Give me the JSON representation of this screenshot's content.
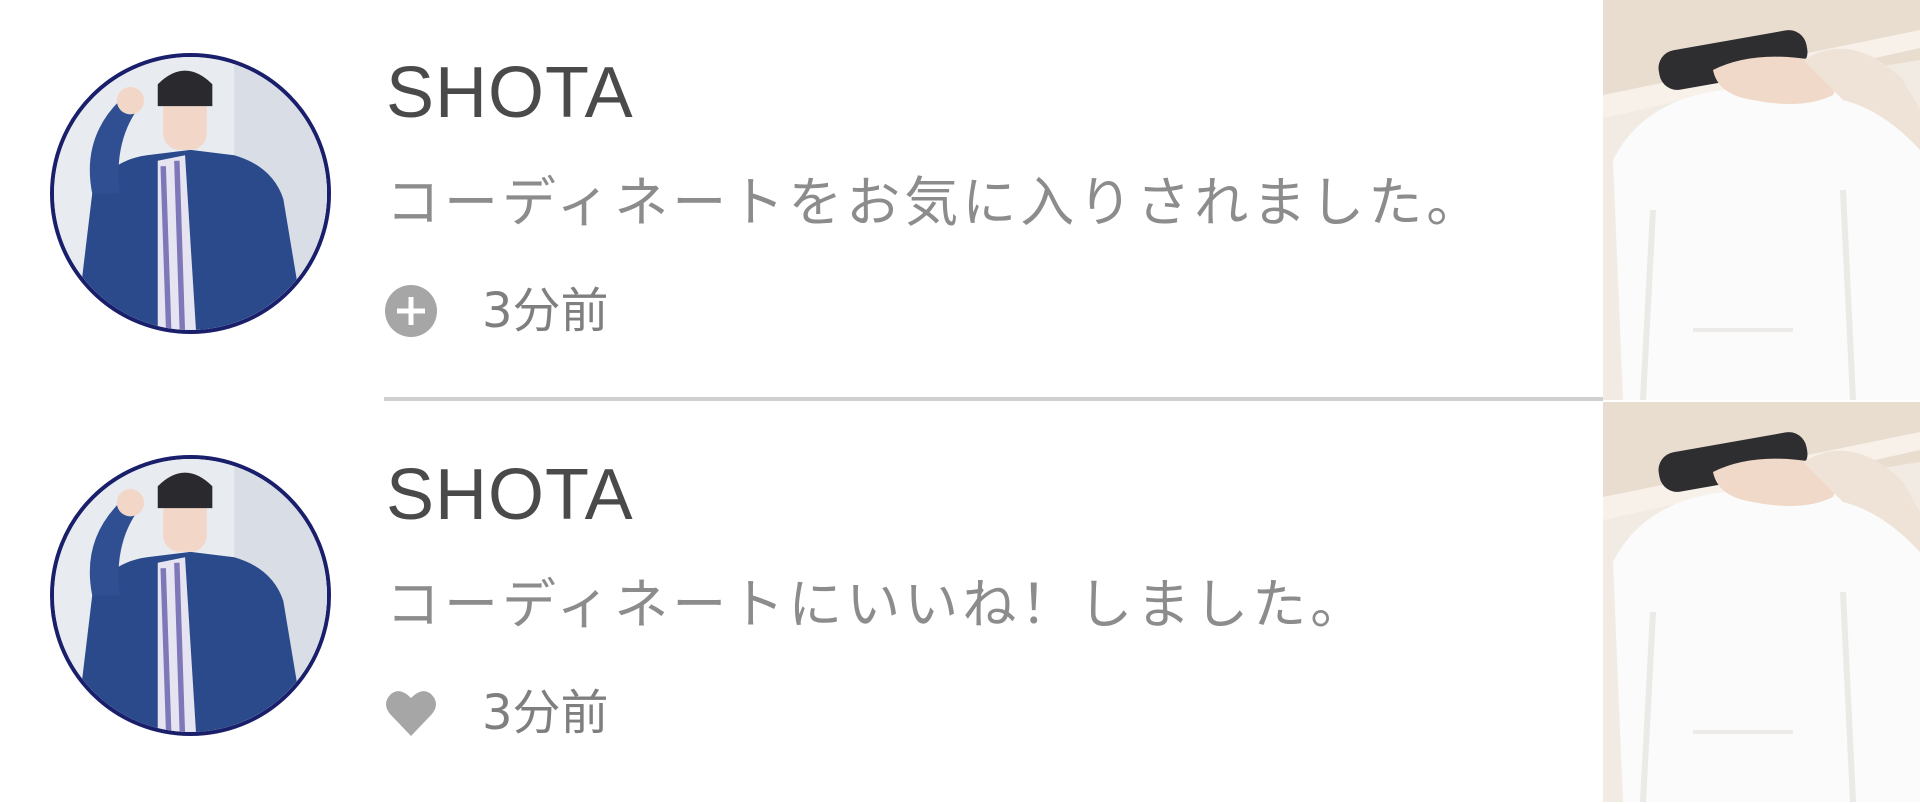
{
  "notifications": [
    {
      "user": "SHOTA",
      "message": "コーディネートをお気に入りされました。",
      "time": "3分前",
      "type_icon": "plus-circle-icon"
    },
    {
      "user": "SHOTA",
      "message": "コーディネートにいいね！しました。",
      "time": "3分前",
      "type_icon": "heart-icon"
    }
  ],
  "colors": {
    "avatar_border": "#1a1f6b",
    "name_text": "#4a4a4a",
    "message_text": "#8c8c8c",
    "icon_gray": "#a6a6a6",
    "divider": "#cfcfcf"
  }
}
